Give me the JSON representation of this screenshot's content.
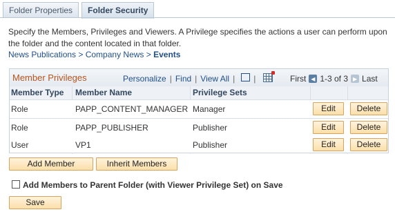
{
  "tabs": [
    {
      "label": "Folder Properties",
      "active": false
    },
    {
      "label": "Folder Security",
      "active": true
    }
  ],
  "description": "Specify the Members, Privileges and Viewers. A Privilege specifies the actions a user can perform upon the folder and the content located in that folder.",
  "breadcrumb": {
    "path": "News Publications > Company News > ",
    "current": "Events"
  },
  "grid": {
    "title": "Member Privileges",
    "links": {
      "personalize": "Personalize",
      "find": "Find",
      "view_all": "View All"
    },
    "nav": {
      "first": "First",
      "range": "1-3 of 3",
      "last": "Last"
    },
    "columns": [
      "Member Type",
      "Member Name",
      "Privilege Sets"
    ],
    "rows": [
      {
        "type": "Role",
        "name": "PAPP_CONTENT_MANAGER",
        "privilege": "Manager",
        "edit": "Edit",
        "delete": "Delete"
      },
      {
        "type": "Role",
        "name": "PAPP_PUBLISHER",
        "privilege": "Publisher",
        "edit": "Edit",
        "delete": "Delete"
      },
      {
        "type": "User",
        "name": "VP1",
        "privilege": "Publisher",
        "edit": "Edit",
        "delete": "Delete"
      }
    ]
  },
  "buttons": {
    "add_member": "Add Member",
    "inherit_members": "Inherit Members",
    "save": "Save"
  },
  "checkbox": {
    "label": "Add Members to Parent Folder (with Viewer Privilege Set) on Save",
    "checked": false
  },
  "colors": {
    "accent": "#b5541e",
    "link": "#1f4e8a",
    "button": "#fbdfa8"
  }
}
